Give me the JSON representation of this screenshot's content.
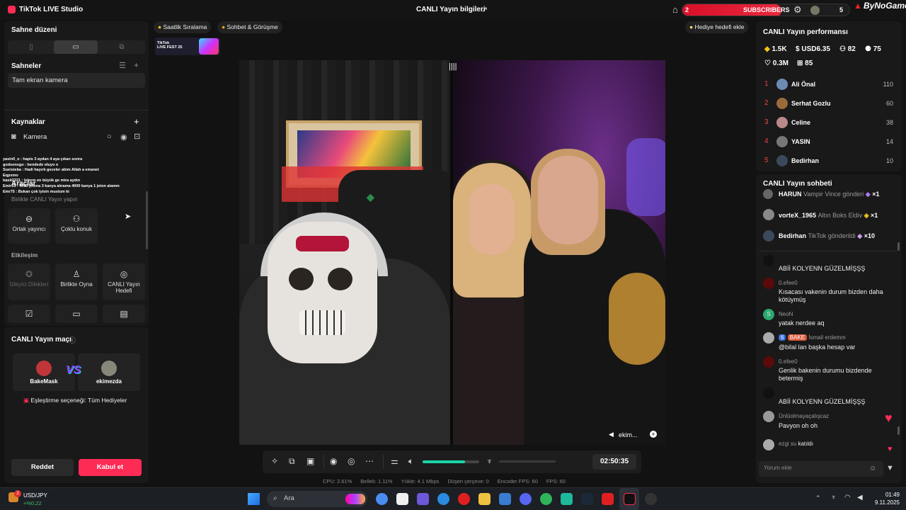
{
  "title_bar": {
    "app_name": "TikTok LIVE Studio",
    "center_title": "CANLI Yayın bilgileri",
    "subs_left": "2",
    "subs_label": "SUBSCRIBERS",
    "subs_right": "5",
    "brand": "ByNoGame",
    "colors": {
      "accent": "#fe2c55",
      "sub_bar": "#d8102a"
    }
  },
  "left": {
    "scene_layout_title": "Sahne düzeni",
    "scenes_title": "Sahneler",
    "scene_item": "Tam ekran kamera",
    "sources_title": "Kaynaklar",
    "source_item": "Kamera",
    "tools_title": "Araçlar",
    "tools_sub": "Birlikte CANLI Yayın yapın",
    "tools": [
      {
        "label": "Ortak yayıncı",
        "icon": "link-icon"
      },
      {
        "label": "Çoklu konuk",
        "icon": "users-icon"
      }
    ],
    "interaction_title": "Etkileşim",
    "interaction": [
      {
        "label": "İzleyici Dilekleri",
        "icon": "wish-icon"
      },
      {
        "label": "Birlikte Oyna",
        "icon": "game-icon"
      },
      {
        "label": "CANLI Yayın Hedefi",
        "icon": "target-icon"
      }
    ],
    "match_title": "CANLI Yayın maçı",
    "match_left": "BakeMask",
    "match_right": "ekimezda",
    "match_vs": "VS",
    "pairing": "Eşleştirme seçeneği: Tüm Hediyeler",
    "reject": "Reddet",
    "accept": "Kabul et"
  },
  "overlay_chat": [
    "yasin0_o : hapis 3 aydan 4 aya çıkan sonra",
    "godsonsgo : bendede oluyo o",
    "Sueisteba : Hadi hayırlı geceler abim Allah a emanet",
    "Eqpxmo",
    "basit2221 : lelnrm en büyük ge mira aydın",
    "Emir15 : 4000 jetona 3 kanya alırama 4000 kanya 1 jeton alamm",
    "Emr75 : Bukan çok iyisin muslum ki"
  ],
  "center": {
    "chip_ranking": "Saatlik Sıralama",
    "chip_chat": "Sohbet & Görüşme",
    "chip_gift_goal": "Hediye hedefi ekle",
    "fest_line1": "TikTok",
    "fest_line2": "LIVE FEST 25",
    "video_guest_name": "ekim...",
    "timer": "02:50:35",
    "stats": {
      "cpu": "CPU: 2.61%",
      "memory": "Bellek: 1.11%",
      "upload": "Yükle: 4.1 Mbps",
      "drop": "Düşen çerçeve: 0",
      "encoder": "Encoder FPS: 60",
      "fps": "FPS: 60"
    },
    "volume_level": 0.75
  },
  "performance": {
    "title": "CANLI Yayın performansı",
    "diamonds": "1.5K",
    "usd": "USD6.35",
    "viewers": "82",
    "followers": "75",
    "likes": "0.3M",
    "gifters": "85"
  },
  "ranking": [
    {
      "rank": "1",
      "name": "Ali Önal",
      "value": "110"
    },
    {
      "rank": "2",
      "name": "Serhat Gozlu",
      "value": "60"
    },
    {
      "rank": "3",
      "name": "Celine",
      "value": "38"
    },
    {
      "rank": "4",
      "name": "YASIN",
      "value": "14"
    },
    {
      "rank": "5",
      "name": "Bedirhan",
      "value": "10"
    }
  ],
  "chat": {
    "title": "CANLI Yayın sohbeti",
    "gifts": [
      {
        "user": "HARUN",
        "text": "Vampir Vince gönderi",
        "count": "×1"
      },
      {
        "user": "vorteX_1965",
        "text": "Altın Boks Eldiv",
        "count": "×1"
      },
      {
        "user": "Bedirhan",
        "text": "TikTok gönderildi",
        "count": "×10"
      }
    ],
    "messages": [
      {
        "user": "",
        "text": "ABİİ KOLYENN GÜZELMİŞŞŞ"
      },
      {
        "user": "0.efee0",
        "text": "Kısacası vakenin durum bizden daha kötüymüş"
      },
      {
        "user": "NeoN",
        "text": "yatak nerdee aq"
      },
      {
        "user": "İsmail erdemm",
        "text": "@bilal lan başka hesap var",
        "badge": "6",
        "badge2": "BAKE"
      },
      {
        "user": "0.efee0",
        "text": "Genlik bakenin durumu bizdende betermiş"
      },
      {
        "user": "",
        "text": "ABİİ KOLYENN GÜZELMİŞŞŞ"
      },
      {
        "user": "Ünlüolmayaçalışcaz",
        "text": "Pavyon oh oh"
      },
      {
        "user": "ezgi su",
        "text": "katıldı"
      }
    ],
    "placeholder": "Yorum ekle"
  },
  "taskbar": {
    "ticker_name": "USD/JPY",
    "ticker_change": "+%0,22",
    "ticker_badge": "2",
    "search_placeholder": "Ara",
    "time": "01:49",
    "date": "9.11.2025"
  }
}
